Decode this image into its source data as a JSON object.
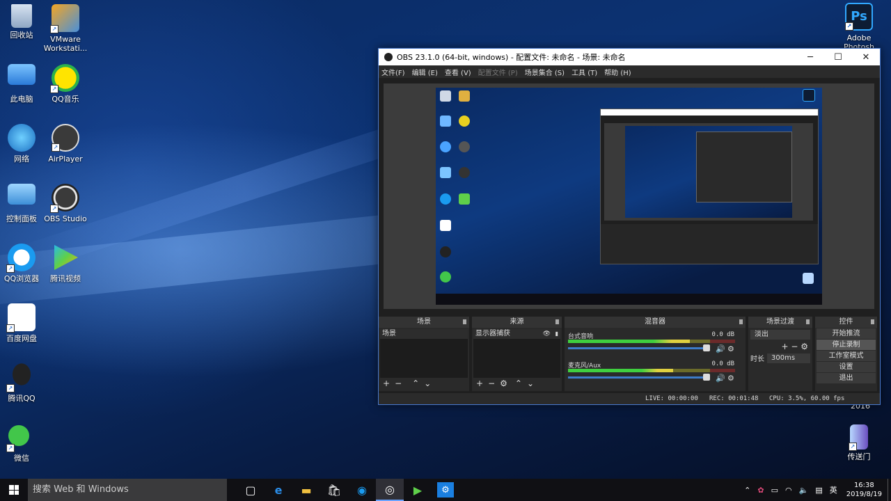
{
  "desktop": {
    "icons_left": [
      {
        "label": "回收站",
        "icon": "recycle-bin-icon"
      },
      {
        "label": "VMware Workstati...",
        "icon": "vmware-icon"
      },
      {
        "label": "此电脑",
        "icon": "computer-icon"
      },
      {
        "label": "QQ音乐",
        "icon": "qq-music-icon"
      },
      {
        "label": "网络",
        "icon": "network-icon"
      },
      {
        "label": "AirPlayer",
        "icon": "airplayer-icon"
      },
      {
        "label": "控制面板",
        "icon": "control-panel-icon"
      },
      {
        "label": "OBS Studio",
        "icon": "obs-icon"
      },
      {
        "label": "QQ浏览器",
        "icon": "qq-browser-icon"
      },
      {
        "label": "腾讯视频",
        "icon": "tencent-video-icon"
      },
      {
        "label": "百度网盘",
        "icon": "baidu-netdisk-icon"
      },
      {
        "label": "腾讯QQ",
        "icon": "qq-icon"
      },
      {
        "label": "微信",
        "icon": "wechat-icon"
      }
    ],
    "icons_right": [
      {
        "label": "Adobe Photosh",
        "icon": "photoshop-icon"
      },
      {
        "label": "传送门",
        "icon": "portal-icon"
      }
    ],
    "partial_text": "2016"
  },
  "obs": {
    "title": "OBS 23.1.0 (64-bit, windows) - 配置文件: 未命名 - 场景: 未命名",
    "menu": [
      "文件(F)",
      "编辑 (E)",
      "查看 (V)",
      "配置文件 (P)",
      "场景集合 (S)",
      "工具 (T)",
      "帮助 (H)"
    ],
    "scenes": {
      "header": "场景",
      "items": [
        "场景"
      ]
    },
    "sources": {
      "header": "来源",
      "items": [
        "显示器捕获"
      ]
    },
    "mixer": {
      "header": "混音器",
      "channels": [
        {
          "name": "台式音响",
          "db": "0.0 dB",
          "level": 0.73
        },
        {
          "name": "麦克风/Aux",
          "db": "0.0 dB",
          "level": 0.63
        }
      ]
    },
    "transitions": {
      "header": "场景过渡",
      "type": "淡出",
      "duration_label": "时长",
      "duration": "300ms"
    },
    "controls": {
      "header": "控件",
      "buttons": [
        "开始推流",
        "停止录制",
        "工作室模式",
        "设置",
        "退出"
      ]
    },
    "status": {
      "live": "LIVE: 00:00:00",
      "rec": "REC: 00:01:48",
      "cpu": "CPU: 3.5%, 60.00 fps"
    }
  },
  "taskbar": {
    "search_placeholder": "搜索 Web 和 Windows",
    "ime": "英",
    "time": "16:38",
    "date": "2019/8/19"
  }
}
